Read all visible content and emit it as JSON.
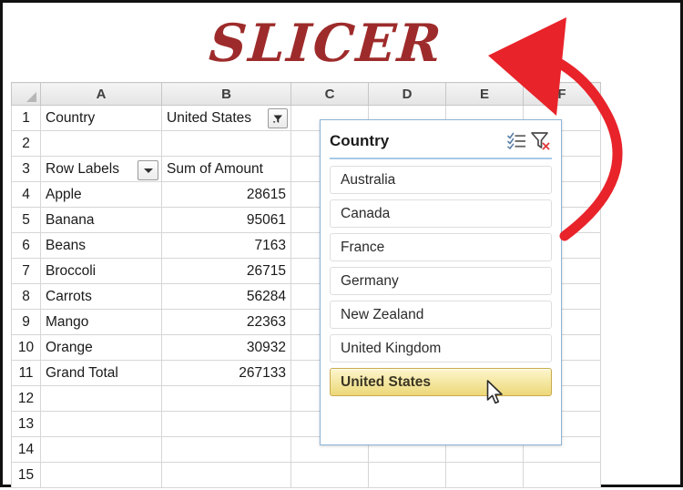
{
  "annotation": {
    "title": "SLICER",
    "title_color": "#9e2b2b",
    "arrow_color": "#e8232a",
    "arrow_name": "red-curved-arrow"
  },
  "spreadsheet": {
    "columns": [
      "A",
      "B",
      "C",
      "D",
      "E",
      "F"
    ],
    "rows": [
      "1",
      "2",
      "3",
      "4",
      "5",
      "6",
      "7",
      "8",
      "9",
      "10",
      "11",
      "12",
      "13",
      "14",
      "15"
    ],
    "cells": {
      "r1": {
        "a": "Country",
        "b": "United States",
        "filter_icon": "filter-icon"
      },
      "r2": {
        "a": "",
        "b": ""
      },
      "r3": {
        "a": "Row Labels",
        "b": "Sum of Amount",
        "dropdown_icon": "chevron-down-icon"
      },
      "data": [
        {
          "label": "Apple",
          "amount": "28615"
        },
        {
          "label": "Banana",
          "amount": "95061"
        },
        {
          "label": "Beans",
          "amount": "7163"
        },
        {
          "label": "Broccoli",
          "amount": "26715"
        },
        {
          "label": "Carrots",
          "amount": "56284"
        },
        {
          "label": "Mango",
          "amount": "22363"
        },
        {
          "label": "Orange",
          "amount": "30932"
        }
      ],
      "total": {
        "label": "Grand Total",
        "amount": "267133"
      }
    },
    "header_highlight_color": "#dbe8f4"
  },
  "slicer": {
    "caption": "Country",
    "multiselect_icon": "multi-select-icon",
    "clear_filter_icon": "clear-filter-icon",
    "items": [
      {
        "label": "Australia",
        "selected": false
      },
      {
        "label": "Canada",
        "selected": false
      },
      {
        "label": "France",
        "selected": false
      },
      {
        "label": "Germany",
        "selected": false
      },
      {
        "label": "New Zealand",
        "selected": false
      },
      {
        "label": "United Kingdom",
        "selected": false
      },
      {
        "label": "United States",
        "selected": true
      }
    ],
    "selected_color": "#ecd878",
    "border_color": "#8db4d8"
  },
  "cursor": {
    "icon": "mouse-pointer-icon"
  }
}
